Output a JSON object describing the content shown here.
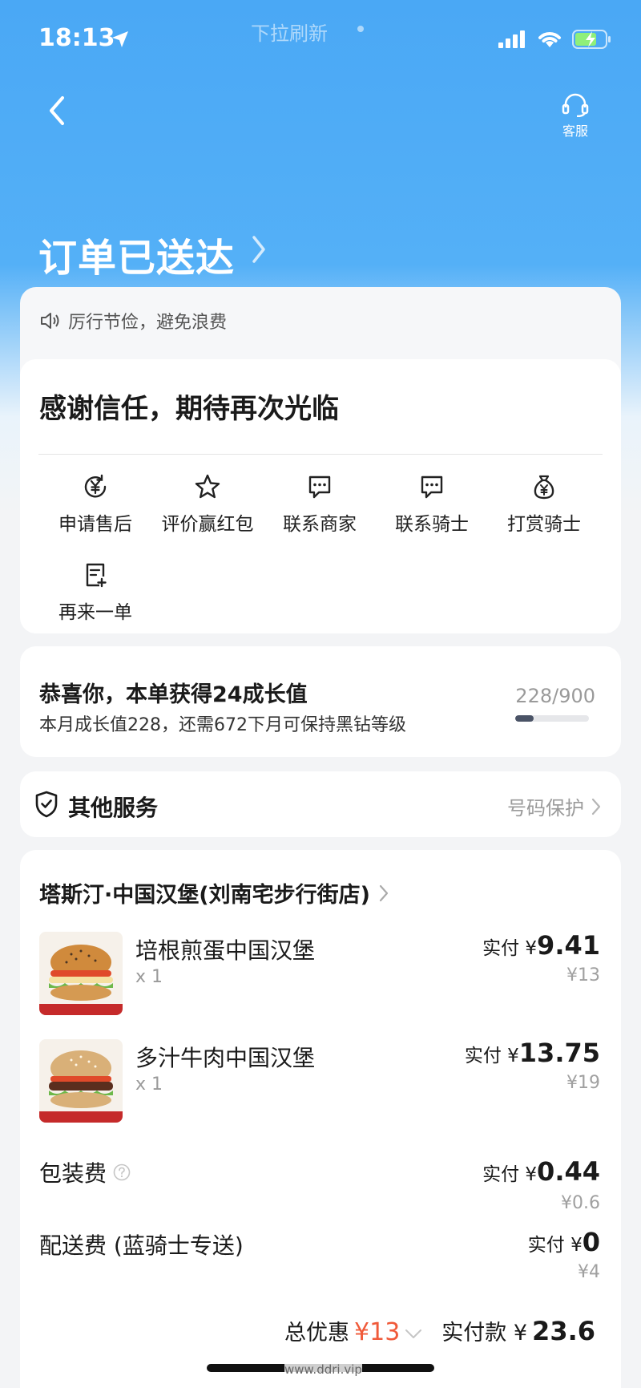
{
  "status_bar": {
    "time": "18:13",
    "pull_hint": "下拉刷新"
  },
  "header": {
    "customer_service": "客服",
    "order_status": "订单已送达"
  },
  "notice": "厉行节俭，避免浪费",
  "thanks": "感谢信任，期待再次光临",
  "actions": [
    {
      "label": "申请售后",
      "icon": "yen-refresh-icon"
    },
    {
      "label": "评价赢红包",
      "icon": "star-icon"
    },
    {
      "label": "联系商家",
      "icon": "chat-icon"
    },
    {
      "label": "联系骑士",
      "icon": "chat-icon"
    },
    {
      "label": "打赏骑士",
      "icon": "money-bag-icon"
    },
    {
      "label": "再来一单",
      "icon": "reorder-icon"
    }
  ],
  "growth": {
    "title": "恭喜你，本单获得24成长值",
    "subtitle": "本月成长值228，还需672下月可保持黑钻等级",
    "progress_text": "228/900",
    "progress": 0.253
  },
  "services": {
    "title": "其他服务",
    "right_label": "号码保护"
  },
  "order": {
    "shop_name": "塔斯汀·中国汉堡(刘南宅步行街店)",
    "items": [
      {
        "name": "培根煎蛋中国汉堡",
        "qty": "x 1",
        "paid_label": "实付 ¥",
        "paid": "9.41",
        "original": "¥13"
      },
      {
        "name": "多汁牛肉中国汉堡",
        "qty": "x 1",
        "paid_label": "实付 ¥",
        "paid": "13.75",
        "original": "¥19"
      }
    ],
    "packaging": {
      "label": "包装费",
      "paid_label": "实付 ¥",
      "paid": "0.44",
      "original": "¥0.6"
    },
    "delivery": {
      "label": "配送费 (蓝骑士专送)",
      "paid_label": "实付 ¥",
      "paid": "0",
      "original": "¥4"
    },
    "total_discount_label": "总优惠",
    "total_discount": "¥13",
    "total_paid_label": "实付款 ¥",
    "total_paid": "23.6"
  },
  "watermark": "www.ddri.vip"
}
